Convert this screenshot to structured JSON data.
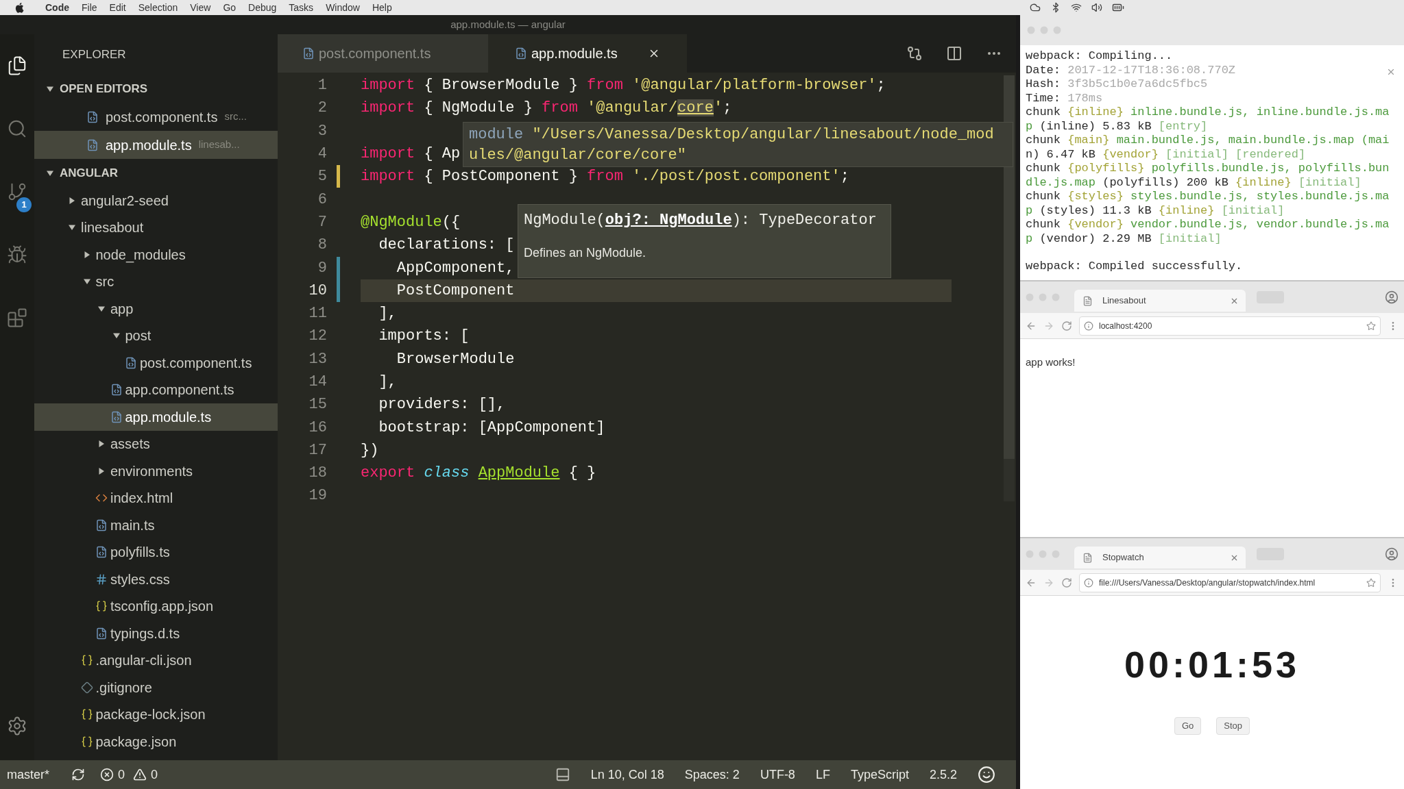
{
  "menu_bar": {
    "items": [
      "Code",
      "File",
      "Edit",
      "Selection",
      "View",
      "Go",
      "Debug",
      "Tasks",
      "Window",
      "Help"
    ]
  },
  "window": {
    "title": "app.module.ts — angular"
  },
  "activity_bar": {
    "items": [
      {
        "kind": "files",
        "selected": true
      },
      {
        "kind": "search",
        "selected": false
      },
      {
        "kind": "source-control",
        "selected": false,
        "badge": "1"
      },
      {
        "kind": "debug",
        "selected": false
      },
      {
        "kind": "extensions",
        "selected": false
      }
    ]
  },
  "sidebar": {
    "title": "EXPLORER",
    "open_editors": {
      "title": "OPEN EDITORS",
      "expanded": true,
      "items": [
        {
          "name": "post.component.ts",
          "description": "src...",
          "kind": "ts-file",
          "selected": false
        },
        {
          "name": "app.module.ts",
          "description": "linesab...",
          "kind": "ts-file",
          "selected": true
        }
      ]
    },
    "project": {
      "title": "ANGULAR",
      "expanded": true,
      "tree": [
        {
          "name": "angular2-seed",
          "kind": "folder",
          "expanded": false,
          "selected": false
        },
        {
          "name": "linesabout",
          "kind": "folder",
          "expanded": true,
          "selected": false,
          "children": [
            {
              "name": "node_modules",
              "kind": "folder",
              "expanded": false,
              "selected": false
            },
            {
              "name": "src",
              "kind": "folder",
              "expanded": true,
              "selected": false,
              "children": [
                {
                  "name": "app",
                  "kind": "folder",
                  "expanded": true,
                  "selected": false,
                  "children": [
                    {
                      "name": "post",
                      "kind": "folder",
                      "expanded": true,
                      "selected": false,
                      "children": [
                        {
                          "name": "post.component.ts",
                          "kind": "ts-file",
                          "selected": false
                        }
                      ]
                    },
                    {
                      "name": "app.component.ts",
                      "kind": "ts-file",
                      "selected": false
                    },
                    {
                      "name": "app.module.ts",
                      "kind": "ts-file",
                      "selected": true
                    }
                  ]
                },
                {
                  "name": "assets",
                  "kind": "folder",
                  "expanded": false,
                  "selected": false
                },
                {
                  "name": "environments",
                  "kind": "folder",
                  "expanded": false,
                  "selected": false
                },
                {
                  "name": "index.html",
                  "kind": "html-file",
                  "selected": false
                },
                {
                  "name": "main.ts",
                  "kind": "ts-file",
                  "selected": false
                },
                {
                  "name": "polyfills.ts",
                  "kind": "ts-file",
                  "selected": false
                },
                {
                  "name": "styles.css",
                  "kind": "css-file",
                  "selected": false
                },
                {
                  "name": "tsconfig.app.json",
                  "kind": "json-file",
                  "selected": false
                },
                {
                  "name": "typings.d.ts",
                  "kind": "ts-file",
                  "selected": false
                }
              ]
            },
            {
              "name": ".angular-cli.json",
              "kind": "json-file",
              "selected": false
            },
            {
              "name": ".gitignore",
              "kind": "ignore-file",
              "selected": false
            },
            {
              "name": "package-lock.json",
              "kind": "json-file",
              "selected": false
            },
            {
              "name": "package.json",
              "kind": "json-file",
              "selected": false
            }
          ]
        }
      ]
    }
  },
  "tabs": [
    {
      "label": "post.component.ts",
      "kind": "ts-file",
      "selected": false
    },
    {
      "label": "app.module.ts",
      "kind": "ts-file",
      "selected": true
    }
  ],
  "editor": {
    "lines": [
      {
        "number": "1",
        "current": false,
        "tokens": [
          {
            "text": "import",
            "kind": "keyword"
          },
          {
            "text": " { BrowserModule } ",
            "kind": "plain"
          },
          {
            "text": "from",
            "kind": "keyword"
          },
          {
            "text": " '@angular/platform-browser'",
            "kind": "string"
          },
          {
            "text": ";",
            "kind": "plain"
          }
        ]
      },
      {
        "number": "2",
        "current": false,
        "tokens": [
          {
            "text": "import",
            "kind": "keyword"
          },
          {
            "text": " { NgModule } ",
            "kind": "plain"
          },
          {
            "text": "from",
            "kind": "keyword"
          },
          {
            "text": " '@angular/",
            "kind": "string"
          },
          {
            "text": "core",
            "kind": "hovered"
          },
          {
            "text": "'",
            "kind": "string"
          },
          {
            "text": ";",
            "kind": "plain"
          }
        ]
      },
      {
        "number": "3",
        "current": false
      },
      {
        "number": "4",
        "current": false,
        "tokens": [
          {
            "text": "import",
            "kind": "keyword"
          },
          {
            "text": " { Ap",
            "kind": "plain"
          }
        ]
      },
      {
        "number": "5",
        "current": false,
        "color": "#d6b84a",
        "tokens": [
          {
            "text": "import",
            "kind": "keyword"
          },
          {
            "text": " { PostComponent } ",
            "kind": "plain"
          },
          {
            "text": "from",
            "kind": "keyword"
          },
          {
            "text": " './post/post.component'",
            "kind": "string"
          },
          {
            "text": ";",
            "kind": "plain"
          }
        ]
      },
      {
        "number": "6",
        "current": false
      },
      {
        "number": "7",
        "current": false,
        "tokens": [
          {
            "text": "@NgModule",
            "kind": "decorator"
          },
          {
            "text": "({",
            "kind": "plain"
          }
        ]
      },
      {
        "number": "8",
        "current": false,
        "tokens": [
          {
            "text": "  declarations: [",
            "kind": "plain"
          }
        ]
      },
      {
        "number": "9",
        "current": false,
        "color": "#3f8a9c",
        "tokens": [
          {
            "text": "    AppComponent,",
            "kind": "plain"
          }
        ]
      },
      {
        "number": "10",
        "current": true,
        "color": "#3f8a9c",
        "tokens": [
          {
            "text": "    PostComponent",
            "kind": "plain"
          }
        ]
      },
      {
        "number": "11",
        "current": false,
        "tokens": [
          {
            "text": "  ],",
            "kind": "plain"
          }
        ]
      },
      {
        "number": "12",
        "current": false,
        "tokens": [
          {
            "text": "  imports: [",
            "kind": "plain"
          }
        ]
      },
      {
        "number": "13",
        "current": false,
        "tokens": [
          {
            "text": "    BrowserModule",
            "kind": "plain"
          }
        ]
      },
      {
        "number": "14",
        "current": false,
        "tokens": [
          {
            "text": "  ],",
            "kind": "plain"
          }
        ]
      },
      {
        "number": "15",
        "current": false,
        "tokens": [
          {
            "text": "  providers: [],",
            "kind": "plain"
          }
        ]
      },
      {
        "number": "16",
        "current": false,
        "tokens": [
          {
            "text": "  bootstrap: [AppComponent]",
            "kind": "plain"
          }
        ]
      },
      {
        "number": "17",
        "current": false,
        "tokens": [
          {
            "text": "})",
            "kind": "plain"
          }
        ]
      },
      {
        "number": "18",
        "current": false,
        "tokens": [
          {
            "text": "export",
            "kind": "keyword"
          },
          {
            "text": " class ",
            "kind": "storage"
          },
          {
            "text": "AppModule",
            "kind": "class-name"
          },
          {
            "text": " { }",
            "kind": "plain"
          }
        ]
      },
      {
        "number": "19",
        "current": false
      }
    ]
  },
  "module_hover": {
    "lines": [
      [
        {
          "text": "module",
          "kind": "label"
        },
        {
          "text": " \"/Users/Vanessa/Desktop/angular/linesabout/node_mod",
          "kind": "string"
        }
      ],
      [
        {
          "text": "ules/@angular/core/core\"",
          "kind": "string"
        }
      ]
    ]
  },
  "signature_hover": {
    "signature": [
      {
        "text": "NgModule(",
        "kind": "plain"
      },
      {
        "text": "obj?: NgModule",
        "kind": "active-param"
      },
      {
        "text": "): TypeDecorator",
        "kind": "plain"
      }
    ],
    "documentation": "Defines an NgModule."
  },
  "status_bar": {
    "branch": "master*",
    "errors": "0",
    "warnings": "0",
    "position": "Ln 10, Col 18",
    "indentation": "Spaces: 2",
    "encoding": "UTF-8",
    "line_ending": "LF",
    "language": "TypeScript",
    "version": "2.5.2"
  },
  "terminal": {
    "output": [
      [
        {
          "text": "webpack: Compiling...",
          "kind": "plain"
        }
      ],
      [
        {
          "text": "Date: ",
          "kind": "plain"
        },
        {
          "text": "2017-12-17T18:36:08.770Z",
          "kind": "muted"
        }
      ],
      [
        {
          "text": "Hash: ",
          "kind": "plain"
        },
        {
          "text": "3f3b5c1b0e7a6dc5fbc5",
          "kind": "muted"
        }
      ],
      [
        {
          "text": "Time: ",
          "kind": "plain"
        },
        {
          "text": "178ms",
          "kind": "muted"
        }
      ],
      [
        {
          "text": "chunk ",
          "kind": "plain"
        },
        {
          "text": "{inline}",
          "kind": "id"
        },
        {
          "text": " inline.bundle.js, inline.bundle.js.ma",
          "kind": "file"
        }
      ],
      [
        {
          "text": "p ",
          "kind": "file"
        },
        {
          "text": "(inline) 5.83 kB ",
          "kind": "plain"
        },
        {
          "text": "[entry]",
          "kind": "flag"
        }
      ],
      [
        {
          "text": "chunk ",
          "kind": "plain"
        },
        {
          "text": "{main}",
          "kind": "id"
        },
        {
          "text": " main.bundle.js, main.bundle.js.map (mai",
          "kind": "file"
        }
      ],
      [
        {
          "text": "n) 6.47 kB ",
          "kind": "plain"
        },
        {
          "text": "{vendor}",
          "kind": "id"
        },
        {
          "text": " [initial] [rendered]",
          "kind": "flag"
        }
      ],
      [
        {
          "text": "chunk ",
          "kind": "plain"
        },
        {
          "text": "{polyfills}",
          "kind": "id"
        },
        {
          "text": " polyfills.bundle.js, polyfills.bun",
          "kind": "file"
        }
      ],
      [
        {
          "text": "dle.js.map ",
          "kind": "file"
        },
        {
          "text": "(polyfills) 200 kB ",
          "kind": "plain"
        },
        {
          "text": "{inline}",
          "kind": "id"
        },
        {
          "text": " [initial]",
          "kind": "flag"
        }
      ],
      [
        {
          "text": "chunk ",
          "kind": "plain"
        },
        {
          "text": "{styles}",
          "kind": "id"
        },
        {
          "text": " styles.bundle.js, styles.bundle.js.ma",
          "kind": "file"
        }
      ],
      [
        {
          "text": "p ",
          "kind": "file"
        },
        {
          "text": "(styles) 11.3 kB ",
          "kind": "plain"
        },
        {
          "text": "{inline}",
          "kind": "id"
        },
        {
          "text": " [initial]",
          "kind": "flag"
        }
      ],
      [
        {
          "text": "chunk ",
          "kind": "plain"
        },
        {
          "text": "{vendor}",
          "kind": "id"
        },
        {
          "text": " vendor.bundle.js, vendor.bundle.js.ma",
          "kind": "file"
        }
      ],
      [
        {
          "text": "p ",
          "kind": "file"
        },
        {
          "text": "(vendor) 2.29 MB ",
          "kind": "plain"
        },
        {
          "text": "[initial]",
          "kind": "flag"
        }
      ]
    ],
    "result": [
      {
        "text": "webpack: Compiled successfully.",
        "kind": "plain"
      }
    ]
  },
  "browsers": [
    {
      "tab": "Linesabout",
      "url": "localhost:4200",
      "content": {
        "kind": "text",
        "text": "app works!"
      }
    },
    {
      "tab": "Stopwatch",
      "url": "file:///Users/Vanessa/Desktop/angular/stopwatch/index.html",
      "content": {
        "kind": "timer",
        "time": "00:01:53",
        "buttons": [
          "Go",
          "Stop"
        ]
      }
    }
  ]
}
